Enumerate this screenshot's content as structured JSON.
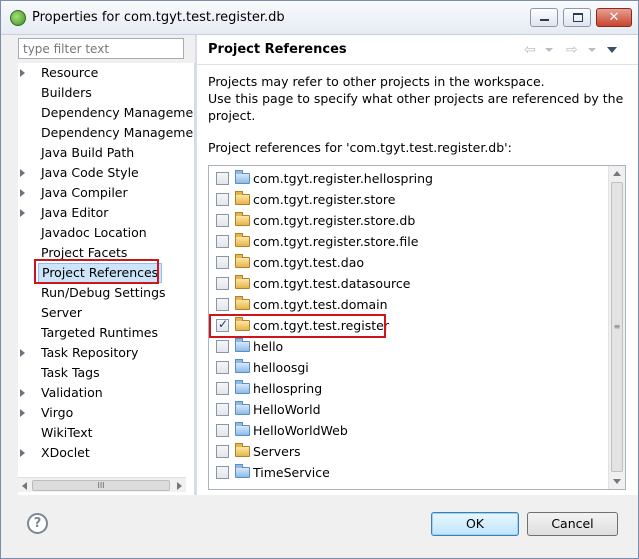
{
  "window": {
    "title": "Properties for com.tgyt.test.register.db",
    "close_glyph": "✕"
  },
  "sidebar": {
    "filter_placeholder": "type filter text",
    "items": [
      {
        "label": "Resource",
        "expandable": true
      },
      {
        "label": "Builders",
        "expandable": false
      },
      {
        "label": "Dependency Manageme",
        "expandable": false
      },
      {
        "label": "Dependency Manageme",
        "expandable": false
      },
      {
        "label": "Java Build Path",
        "expandable": false
      },
      {
        "label": "Java Code Style",
        "expandable": true
      },
      {
        "label": "Java Compiler",
        "expandable": true
      },
      {
        "label": "Java Editor",
        "expandable": true
      },
      {
        "label": "Javadoc Location",
        "expandable": false
      },
      {
        "label": "Project Facets",
        "expandable": false
      },
      {
        "label": "Project References",
        "expandable": false,
        "selected": true
      },
      {
        "label": "Run/Debug Settings",
        "expandable": false
      },
      {
        "label": "Server",
        "expandable": false
      },
      {
        "label": "Targeted Runtimes",
        "expandable": false
      },
      {
        "label": "Task Repository",
        "expandable": true
      },
      {
        "label": "Task Tags",
        "expandable": false
      },
      {
        "label": "Validation",
        "expandable": true
      },
      {
        "label": "Virgo",
        "expandable": true
      },
      {
        "label": "WikiText",
        "expandable": false
      },
      {
        "label": "XDoclet",
        "expandable": true
      }
    ],
    "scroll_grip": "III"
  },
  "page": {
    "title": "Project References",
    "description_line1": "Projects may refer to other projects in the workspace.",
    "description_line2": "Use this page to specify what other projects are referenced by the project.",
    "refs_label": "Project references for 'com.tgyt.test.register.db':",
    "nav_back_glyph": "⇦",
    "nav_forward_glyph": "⇨",
    "scroll_grip": "≡",
    "projects": [
      {
        "name": "com.tgyt.register.hellospring",
        "checked": false,
        "open": false
      },
      {
        "name": "com.tgyt.register.store",
        "checked": false,
        "open": true
      },
      {
        "name": "com.tgyt.register.store.db",
        "checked": false,
        "open": true
      },
      {
        "name": "com.tgyt.register.store.file",
        "checked": false,
        "open": true
      },
      {
        "name": "com.tgyt.test.dao",
        "checked": false,
        "open": true
      },
      {
        "name": "com.tgyt.test.datasource",
        "checked": false,
        "open": true
      },
      {
        "name": "com.tgyt.test.domain",
        "checked": false,
        "open": true
      },
      {
        "name": "com.tgyt.test.register",
        "checked": true,
        "open": true
      },
      {
        "name": "hello",
        "checked": false,
        "open": false
      },
      {
        "name": "helloosgi",
        "checked": false,
        "open": false
      },
      {
        "name": "hellospring",
        "checked": false,
        "open": false
      },
      {
        "name": "HelloWorld",
        "checked": false,
        "open": false
      },
      {
        "name": "HelloWorldWeb",
        "checked": false,
        "open": false
      },
      {
        "name": "Servers",
        "checked": false,
        "open": true
      },
      {
        "name": "TimeService",
        "checked": false,
        "open": false
      }
    ]
  },
  "footer": {
    "help_label": "?",
    "ok_label": "OK",
    "cancel_label": "Cancel"
  }
}
